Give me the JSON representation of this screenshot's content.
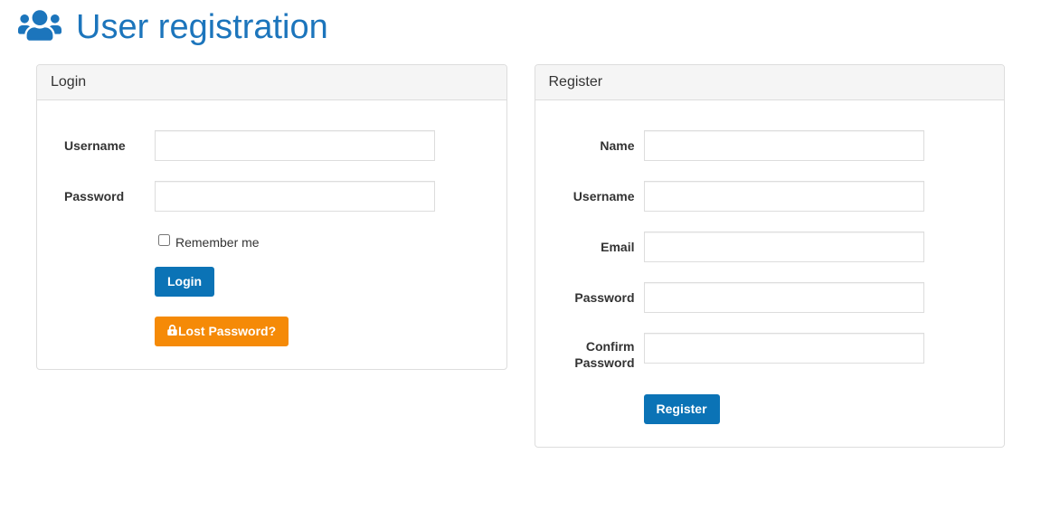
{
  "page": {
    "title": "User registration"
  },
  "login": {
    "heading": "Login",
    "username_label": "Username",
    "username_value": "",
    "password_label": "Password",
    "password_value": "",
    "remember_checked": false,
    "remember_label": "Remember me",
    "login_button": "Login",
    "lost_password_button": "Lost Password?"
  },
  "register": {
    "heading": "Register",
    "name_label": "Name",
    "name_value": "",
    "username_label": "Username",
    "username_value": "",
    "email_label": "Email",
    "email_value": "",
    "password_label": "Password",
    "password_value": "",
    "confirm_label": "Confirm Password",
    "confirm_value": "",
    "register_button": "Register"
  }
}
